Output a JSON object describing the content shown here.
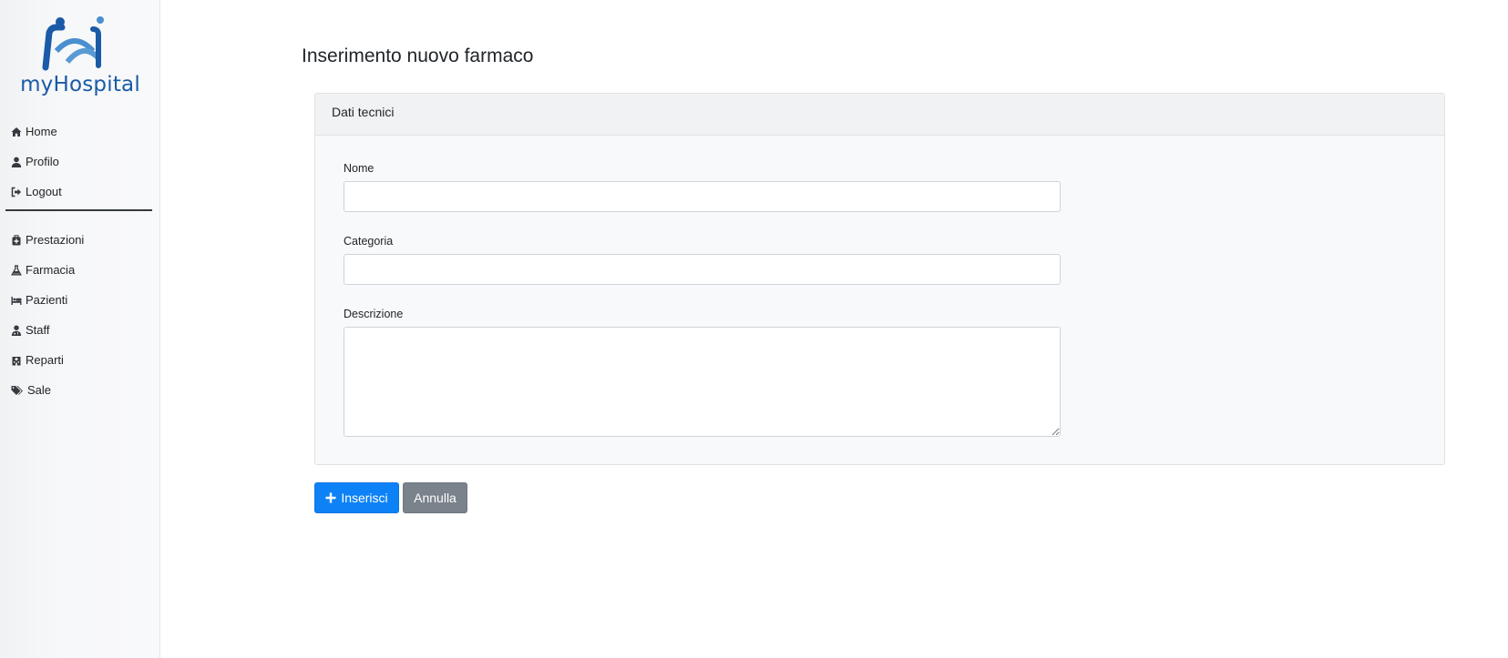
{
  "app": {
    "logo_text": "myHospital",
    "brand_color": "#1a5aa6"
  },
  "sidebar": {
    "main_items": [
      {
        "label": "Home",
        "icon": "home-icon"
      },
      {
        "label": "Profilo",
        "icon": "user-icon"
      },
      {
        "label": "Logout",
        "icon": "sign-out-icon"
      }
    ],
    "secondary_items": [
      {
        "label": "Prestazioni",
        "icon": "medkit-icon"
      },
      {
        "label": "Farmacia",
        "icon": "flask-icon"
      },
      {
        "label": "Pazienti",
        "icon": "bed-icon"
      },
      {
        "label": "Staff",
        "icon": "user-md-icon"
      },
      {
        "label": "Reparti",
        "icon": "hospital-icon"
      },
      {
        "label": "Sale",
        "icon": "tags-icon"
      }
    ]
  },
  "main": {
    "title": "Inserimento nuovo farmaco",
    "card": {
      "header": "Dati tecnici",
      "fields": {
        "nome": {
          "label": "Nome",
          "value": "",
          "placeholder": ""
        },
        "categoria": {
          "label": "Categoria",
          "value": "",
          "placeholder": ""
        },
        "descrizione": {
          "label": "Descrizione",
          "value": "",
          "placeholder": ""
        }
      }
    },
    "actions": {
      "insert_label": "Inserisci",
      "cancel_label": "Annulla",
      "primary_color": "#0d82f6",
      "secondary_color": "#7a838b"
    }
  }
}
